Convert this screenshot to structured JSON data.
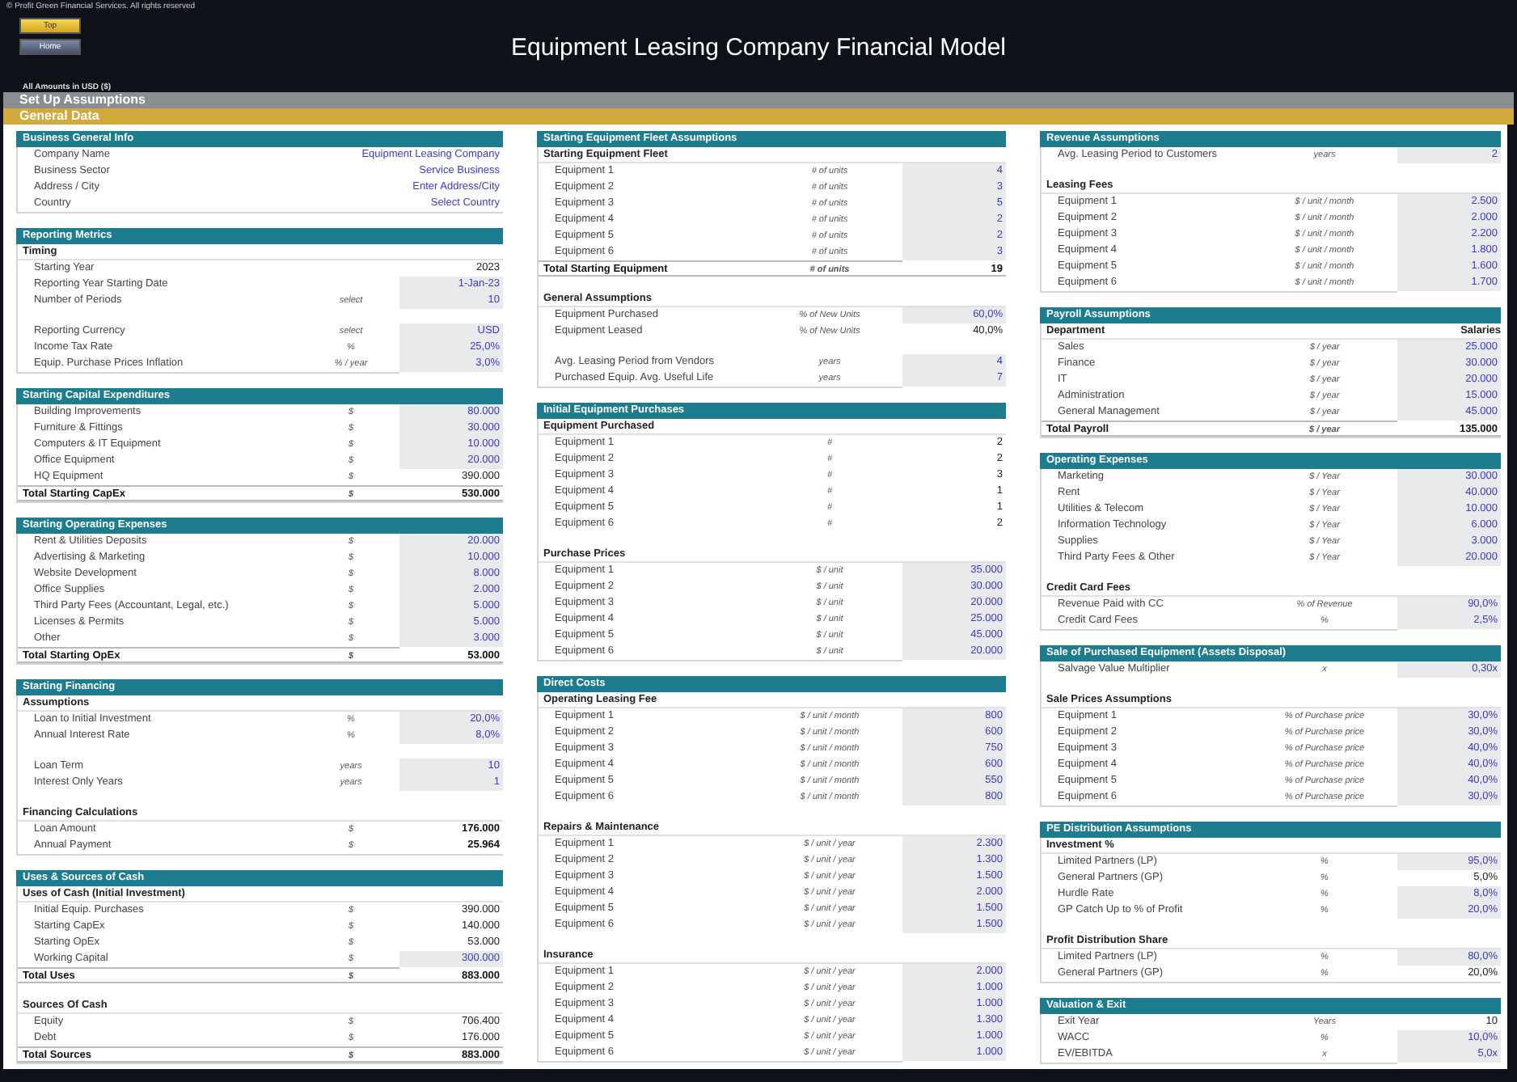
{
  "copyright": "© Profit Green Financial Services. All rights reserved",
  "nav_buttons": [
    {
      "label": "Top",
      "kind": "top"
    },
    {
      "label": "Home",
      "kind": "home"
    }
  ],
  "title": "Equipment Leasing Company Financial Model",
  "currency_note": "All Amounts in USD ($)",
  "sheet_bar": "Set Up Assumptions",
  "section_bar": "General Data",
  "columns": [
    {
      "sections": [
        {
          "title": "Business General Info",
          "groups": [
            {
              "rows": [
                {
                  "label": "Company Name",
                  "unit": "",
                  "value": "Equipment Leasing Company",
                  "kind": "text"
                },
                {
                  "label": "Business Sector",
                  "unit": "",
                  "value": "Service Business",
                  "kind": "text"
                },
                {
                  "label": "Address / City",
                  "unit": "",
                  "value": "Enter Address/City",
                  "kind": "text"
                },
                {
                  "label": "Country",
                  "unit": "",
                  "value": "Select Country",
                  "kind": "text"
                }
              ]
            }
          ]
        },
        {
          "title": "Reporting Metrics",
          "groups": [
            {
              "heading": "Timing",
              "rows": [
                {
                  "label": "Starting Year",
                  "unit": "",
                  "value": "2023",
                  "kind": "calc"
                },
                {
                  "label": "Reporting Year Starting Date",
                  "unit": "",
                  "value": "1-Jan-23",
                  "kind": "input"
                },
                {
                  "label": "Number of Periods",
                  "unit": "select",
                  "value": "10",
                  "kind": "input"
                }
              ]
            },
            {
              "rows": [
                {
                  "label": "Reporting Currency",
                  "unit": "select",
                  "value": "USD",
                  "kind": "input"
                },
                {
                  "label": "Income Tax Rate",
                  "unit": "%",
                  "value": "25,0%",
                  "kind": "input"
                },
                {
                  "label": "Equip. Purchase Prices Inflation",
                  "unit": "% / year",
                  "value": "3,0%",
                  "kind": "input"
                }
              ]
            }
          ]
        },
        {
          "title": "Starting Capital Expenditures",
          "groups": [
            {
              "rows": [
                {
                  "label": "Building Improvements",
                  "unit": "$",
                  "value": "80.000",
                  "kind": "input"
                },
                {
                  "label": "Furniture & Fittings",
                  "unit": "$",
                  "value": "30.000",
                  "kind": "input"
                },
                {
                  "label": "Computers & IT Equipment",
                  "unit": "$",
                  "value": "10.000",
                  "kind": "input"
                },
                {
                  "label": "Office Equipment",
                  "unit": "$",
                  "value": "20.000",
                  "kind": "input"
                },
                {
                  "label": "HQ Equipment",
                  "unit": "$",
                  "value": "390.000",
                  "kind": "calc"
                },
                {
                  "label": "Total Starting CapEx",
                  "unit": "$",
                  "value": "530.000",
                  "kind": "total"
                }
              ]
            }
          ]
        },
        {
          "title": "Starting Operating Expenses",
          "groups": [
            {
              "rows": [
                {
                  "label": "Rent & Utilities Deposits",
                  "unit": "$",
                  "value": "20.000",
                  "kind": "input"
                },
                {
                  "label": "Advertising & Marketing",
                  "unit": "$",
                  "value": "10.000",
                  "kind": "input"
                },
                {
                  "label": "Website Development",
                  "unit": "$",
                  "value": "8.000",
                  "kind": "input"
                },
                {
                  "label": "Office Supplies",
                  "unit": "$",
                  "value": "2.000",
                  "kind": "input"
                },
                {
                  "label": "Third Party Fees (Accountant, Legal, etc.)",
                  "unit": "$",
                  "value": "5.000",
                  "kind": "input"
                },
                {
                  "label": "Licenses & Permits",
                  "unit": "$",
                  "value": "5.000",
                  "kind": "input"
                },
                {
                  "label": "Other",
                  "unit": "$",
                  "value": "3.000",
                  "kind": "input"
                },
                {
                  "label": "Total Starting OpEx",
                  "unit": "$",
                  "value": "53.000",
                  "kind": "total"
                }
              ]
            }
          ]
        },
        {
          "title": "Starting Financing",
          "groups": [
            {
              "heading": "Assumptions",
              "rows": [
                {
                  "label": "Loan to Initial Investment",
                  "unit": "%",
                  "value": "20,0%",
                  "kind": "input"
                },
                {
                  "label": "Annual Interest Rate",
                  "unit": "%",
                  "value": "8,0%",
                  "kind": "input"
                }
              ]
            },
            {
              "rows": [
                {
                  "label": "Loan Term",
                  "unit": "years",
                  "value": "10",
                  "kind": "input"
                },
                {
                  "label": "Interest Only Years",
                  "unit": "years",
                  "value": "1",
                  "kind": "input"
                }
              ]
            },
            {
              "heading": "Financing Calculations",
              "rows": [
                {
                  "label": "Loan Amount",
                  "unit": "$",
                  "value": "176.000",
                  "kind": "bold"
                },
                {
                  "label": "Annual Payment",
                  "unit": "$",
                  "value": "25.964",
                  "kind": "bold"
                }
              ]
            }
          ]
        },
        {
          "title": "Uses & Sources of Cash",
          "groups": [
            {
              "heading": "Uses of Cash (Initial Investment)",
              "rows": [
                {
                  "label": "Initial Equip. Purchases",
                  "unit": "$",
                  "value": "390.000",
                  "kind": "calc"
                },
                {
                  "label": "Starting CapEx",
                  "unit": "$",
                  "value": "140.000",
                  "kind": "calc"
                },
                {
                  "label": "Starting OpEx",
                  "unit": "$",
                  "value": "53.000",
                  "kind": "calc"
                },
                {
                  "label": "Working Capital",
                  "unit": "$",
                  "value": "300.000",
                  "kind": "input"
                },
                {
                  "label": "Total Uses",
                  "unit": "$",
                  "value": "883.000",
                  "kind": "total"
                }
              ]
            },
            {
              "heading": "Sources Of Cash",
              "rows": [
                {
                  "label": "Equity",
                  "unit": "$",
                  "value": "706.400",
                  "kind": "calc"
                },
                {
                  "label": "Debt",
                  "unit": "$",
                  "value": "176.000",
                  "kind": "calc"
                },
                {
                  "label": "Total Sources",
                  "unit": "$",
                  "value": "883.000",
                  "kind": "total"
                }
              ]
            }
          ]
        }
      ]
    },
    {
      "sections": [
        {
          "title": "Starting Equipment Fleet Assumptions",
          "groups": [
            {
              "heading": "Starting Equipment Fleet",
              "rows": [
                {
                  "label": "Equipment 1",
                  "unit": "# of units",
                  "value": "4",
                  "kind": "input"
                },
                {
                  "label": "Equipment 2",
                  "unit": "# of units",
                  "value": "3",
                  "kind": "input"
                },
                {
                  "label": "Equipment 3",
                  "unit": "# of units",
                  "value": "5",
                  "kind": "input"
                },
                {
                  "label": "Equipment 4",
                  "unit": "# of units",
                  "value": "2",
                  "kind": "input"
                },
                {
                  "label": "Equipment 5",
                  "unit": "# of units",
                  "value": "2",
                  "kind": "input"
                },
                {
                  "label": "Equipment 6",
                  "unit": "# of units",
                  "value": "3",
                  "kind": "input"
                },
                {
                  "label": "Total Starting Equipment",
                  "unit": "# of units",
                  "value": "19",
                  "kind": "total"
                }
              ]
            },
            {
              "heading": "General Assumptions",
              "rows": [
                {
                  "label": "Equipment Purchased",
                  "unit": "% of New Units",
                  "value": "60,0%",
                  "kind": "input"
                },
                {
                  "label": "Equipment Leased",
                  "unit": "% of New Units",
                  "value": "40,0%",
                  "kind": "calc"
                }
              ]
            },
            {
              "rows": [
                {
                  "label": "Avg. Leasing Period from Vendors",
                  "unit": "years",
                  "value": "4",
                  "kind": "input"
                },
                {
                  "label": "Purchased Equip. Avg. Useful Life",
                  "unit": "years",
                  "value": "7",
                  "kind": "input"
                }
              ]
            }
          ]
        },
        {
          "title": "Initial Equipment Purchases",
          "groups": [
            {
              "heading": "Equipment Purchased",
              "rows": [
                {
                  "label": "Equipment 1",
                  "unit": "#",
                  "value": "2",
                  "kind": "calc"
                },
                {
                  "label": "Equipment 2",
                  "unit": "#",
                  "value": "2",
                  "kind": "calc"
                },
                {
                  "label": "Equipment 3",
                  "unit": "#",
                  "value": "3",
                  "kind": "calc"
                },
                {
                  "label": "Equipment 4",
                  "unit": "#",
                  "value": "1",
                  "kind": "calc"
                },
                {
                  "label": "Equipment 5",
                  "unit": "#",
                  "value": "1",
                  "kind": "calc"
                },
                {
                  "label": "Equipment 6",
                  "unit": "#",
                  "value": "2",
                  "kind": "calc"
                }
              ]
            },
            {
              "heading": "Purchase Prices",
              "rows": [
                {
                  "label": "Equipment 1",
                  "unit": "$ / unit",
                  "value": "35.000",
                  "kind": "input"
                },
                {
                  "label": "Equipment 2",
                  "unit": "$ / unit",
                  "value": "30.000",
                  "kind": "input"
                },
                {
                  "label": "Equipment 3",
                  "unit": "$ / unit",
                  "value": "20.000",
                  "kind": "input"
                },
                {
                  "label": "Equipment 4",
                  "unit": "$ / unit",
                  "value": "25.000",
                  "kind": "input"
                },
                {
                  "label": "Equipment 5",
                  "unit": "$ / unit",
                  "value": "45.000",
                  "kind": "input"
                },
                {
                  "label": "Equipment 6",
                  "unit": "$ / unit",
                  "value": "20.000",
                  "kind": "input"
                }
              ]
            }
          ]
        },
        {
          "title": "Direct Costs",
          "groups": [
            {
              "heading": "Operating Leasing Fee",
              "rows": [
                {
                  "label": "Equipment 1",
                  "unit": "$ / unit / month",
                  "value": "800",
                  "kind": "input"
                },
                {
                  "label": "Equipment 2",
                  "unit": "$ / unit / month",
                  "value": "600",
                  "kind": "input"
                },
                {
                  "label": "Equipment 3",
                  "unit": "$ / unit / month",
                  "value": "750",
                  "kind": "input"
                },
                {
                  "label": "Equipment 4",
                  "unit": "$ / unit / month",
                  "value": "600",
                  "kind": "input"
                },
                {
                  "label": "Equipment 5",
                  "unit": "$ / unit / month",
                  "value": "550",
                  "kind": "input"
                },
                {
                  "label": "Equipment 6",
                  "unit": "$ / unit / month",
                  "value": "800",
                  "kind": "input"
                }
              ]
            },
            {
              "heading": "Repairs & Maintenance",
              "rows": [
                {
                  "label": "Equipment 1",
                  "unit": "$ / unit / year",
                  "value": "2.300",
                  "kind": "input"
                },
                {
                  "label": "Equipment 2",
                  "unit": "$ / unit / year",
                  "value": "1.300",
                  "kind": "input"
                },
                {
                  "label": "Equipment 3",
                  "unit": "$ / unit / year",
                  "value": "1.500",
                  "kind": "input"
                },
                {
                  "label": "Equipment 4",
                  "unit": "$ / unit / year",
                  "value": "2.000",
                  "kind": "input"
                },
                {
                  "label": "Equipment 5",
                  "unit": "$ / unit / year",
                  "value": "1.500",
                  "kind": "input"
                },
                {
                  "label": "Equipment 6",
                  "unit": "$ / unit / year",
                  "value": "1.500",
                  "kind": "input"
                }
              ]
            },
            {
              "heading": "Insurance",
              "rows": [
                {
                  "label": "Equipment 1",
                  "unit": "$ / unit / year",
                  "value": "2.000",
                  "kind": "input"
                },
                {
                  "label": "Equipment 2",
                  "unit": "$ / unit / year",
                  "value": "1.000",
                  "kind": "input"
                },
                {
                  "label": "Equipment 3",
                  "unit": "$ / unit / year",
                  "value": "1.000",
                  "kind": "input"
                },
                {
                  "label": "Equipment 4",
                  "unit": "$ / unit / year",
                  "value": "1.300",
                  "kind": "input"
                },
                {
                  "label": "Equipment 5",
                  "unit": "$ / unit / year",
                  "value": "1.000",
                  "kind": "input"
                },
                {
                  "label": "Equipment 6",
                  "unit": "$ / unit / year",
                  "value": "1.000",
                  "kind": "input"
                }
              ]
            }
          ]
        }
      ]
    },
    {
      "sections": [
        {
          "title": "Revenue Assumptions",
          "groups": [
            {
              "rows": [
                {
                  "label": "Avg. Leasing Period to Customers",
                  "unit": "years",
                  "value": "2",
                  "kind": "input"
                }
              ]
            },
            {
              "heading": "Leasing Fees",
              "rows": [
                {
                  "label": "Equipment 1",
                  "unit": "$ / unit / month",
                  "value": "2.500",
                  "kind": "input"
                },
                {
                  "label": "Equipment 2",
                  "unit": "$ / unit / month",
                  "value": "2.000",
                  "kind": "input"
                },
                {
                  "label": "Equipment 3",
                  "unit": "$ / unit / month",
                  "value": "2.200",
                  "kind": "input"
                },
                {
                  "label": "Equipment 4",
                  "unit": "$ / unit / month",
                  "value": "1.800",
                  "kind": "input"
                },
                {
                  "label": "Equipment 5",
                  "unit": "$ / unit / month",
                  "value": "1.600",
                  "kind": "input"
                },
                {
                  "label": "Equipment 6",
                  "unit": "$ / unit / month",
                  "value": "1.700",
                  "kind": "input"
                }
              ]
            }
          ]
        },
        {
          "title": "Payroll Assumptions",
          "groups": [
            {
              "heading": "Department",
              "heading_value": "Salaries",
              "rows": [
                {
                  "label": "Sales",
                  "unit": "$ / year",
                  "value": "25.000",
                  "kind": "input"
                },
                {
                  "label": "Finance",
                  "unit": "$ / year",
                  "value": "30.000",
                  "kind": "input"
                },
                {
                  "label": "IT",
                  "unit": "$ / year",
                  "value": "20.000",
                  "kind": "input"
                },
                {
                  "label": "Administration",
                  "unit": "$ / year",
                  "value": "15.000",
                  "kind": "input"
                },
                {
                  "label": "General Management",
                  "unit": "$ / year",
                  "value": "45.000",
                  "kind": "input"
                },
                {
                  "label": "Total Payroll",
                  "unit": "$ / year",
                  "value": "135.000",
                  "kind": "total"
                }
              ]
            }
          ]
        },
        {
          "title": "Operating Expenses",
          "groups": [
            {
              "rows": [
                {
                  "label": "Marketing",
                  "unit": "$ / Year",
                  "value": "30.000",
                  "kind": "input"
                },
                {
                  "label": "Rent",
                  "unit": "$ / Year",
                  "value": "40.000",
                  "kind": "input"
                },
                {
                  "label": "Utilities & Telecom",
                  "unit": "$ / Year",
                  "value": "10.000",
                  "kind": "input"
                },
                {
                  "label": "Information Technology",
                  "unit": "$ / Year",
                  "value": "6.000",
                  "kind": "input"
                },
                {
                  "label": "Supplies",
                  "unit": "$ / Year",
                  "value": "3.000",
                  "kind": "input"
                },
                {
                  "label": "Third Party Fees & Other",
                  "unit": "$ / Year",
                  "value": "20.000",
                  "kind": "input"
                }
              ]
            },
            {
              "heading": "Credit Card Fees",
              "rows": [
                {
                  "label": "Revenue Paid with CC",
                  "unit": "% of Revenue",
                  "value": "90,0%",
                  "kind": "input"
                },
                {
                  "label": "Credit Card Fees",
                  "unit": "%",
                  "value": "2,5%",
                  "kind": "input"
                }
              ]
            }
          ]
        },
        {
          "title": "Sale of Purchased Equipment (Assets Disposal)",
          "groups": [
            {
              "rows": [
                {
                  "label": "Salvage Value Multiplier",
                  "unit": "x",
                  "value": "0,30x",
                  "kind": "input"
                }
              ]
            },
            {
              "heading": "Sale Prices Assumptions",
              "rows": [
                {
                  "label": "Equipment 1",
                  "unit": "% of Purchase price",
                  "value": "30,0%",
                  "kind": "input"
                },
                {
                  "label": "Equipment 2",
                  "unit": "% of Purchase price",
                  "value": "30,0%",
                  "kind": "input"
                },
                {
                  "label": "Equipment 3",
                  "unit": "% of Purchase price",
                  "value": "40,0%",
                  "kind": "input"
                },
                {
                  "label": "Equipment 4",
                  "unit": "% of Purchase price",
                  "value": "40,0%",
                  "kind": "input"
                },
                {
                  "label": "Equipment 5",
                  "unit": "% of Purchase price",
                  "value": "40,0%",
                  "kind": "input"
                },
                {
                  "label": "Equipment 6",
                  "unit": "% of Purchase price",
                  "value": "30,0%",
                  "kind": "input"
                }
              ]
            }
          ]
        },
        {
          "title": "PE Distribution Assumptions",
          "groups": [
            {
              "heading": "Investment %",
              "rows": [
                {
                  "label": "Limited Partners (LP)",
                  "unit": "%",
                  "value": "95,0%",
                  "kind": "input"
                },
                {
                  "label": "General Partners (GP)",
                  "unit": "%",
                  "value": "5,0%",
                  "kind": "calc"
                },
                {
                  "label": "Hurdle Rate",
                  "unit": "%",
                  "value": "8,0%",
                  "kind": "input"
                },
                {
                  "label": "GP Catch Up to % of Profit",
                  "unit": "%",
                  "value": "20,0%",
                  "kind": "input"
                }
              ]
            },
            {
              "heading": "Profit Distribution Share",
              "rows": [
                {
                  "label": "Limited Partners (LP)",
                  "unit": "%",
                  "value": "80,0%",
                  "kind": "input"
                },
                {
                  "label": "General Partners (GP)",
                  "unit": "%",
                  "value": "20,0%",
                  "kind": "calc"
                }
              ]
            }
          ]
        },
        {
          "title": "Valuation & Exit",
          "groups": [
            {
              "rows": [
                {
                  "label": "Exit Year",
                  "unit": "Years",
                  "value": "10",
                  "kind": "calc"
                },
                {
                  "label": "WACC",
                  "unit": "%",
                  "value": "10,0%",
                  "kind": "input"
                },
                {
                  "label": "EV/EBITDA",
                  "unit": "x",
                  "value": "5,0x",
                  "kind": "input"
                }
              ]
            }
          ]
        }
      ]
    }
  ]
}
